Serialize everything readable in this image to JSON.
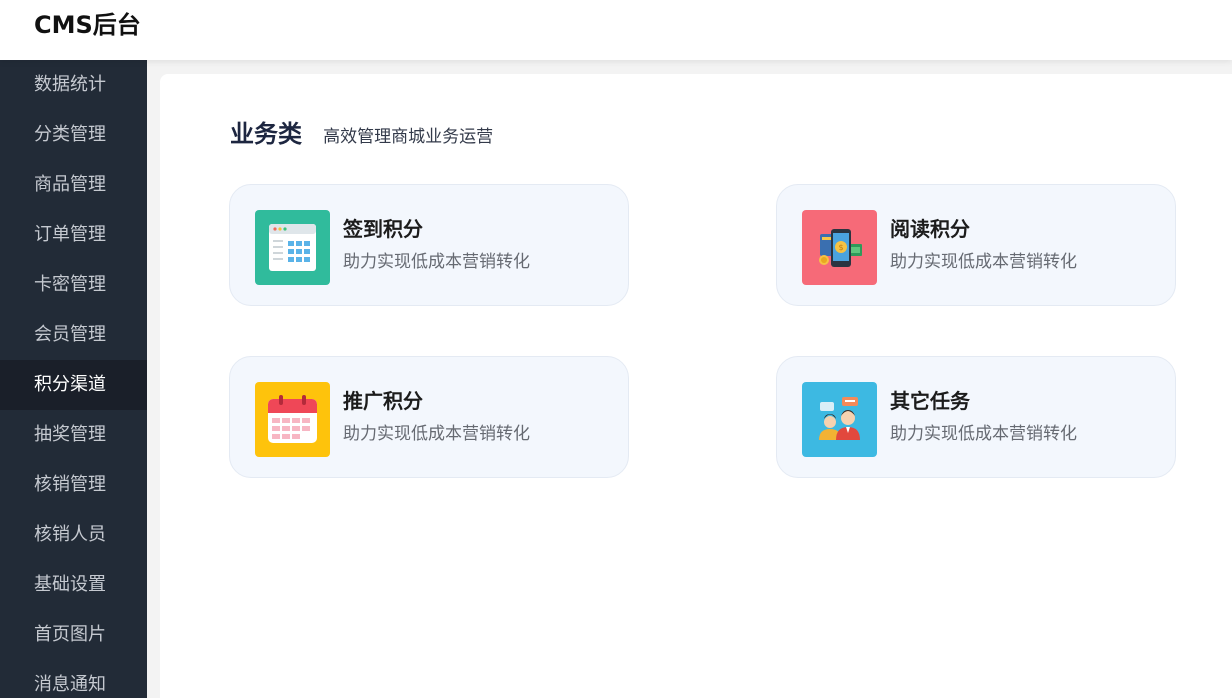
{
  "header": {
    "logo": "CMS后台"
  },
  "sidebar": {
    "items": [
      {
        "label": "数据统计"
      },
      {
        "label": "分类管理"
      },
      {
        "label": "商品管理"
      },
      {
        "label": "订单管理"
      },
      {
        "label": "卡密管理"
      },
      {
        "label": "会员管理"
      },
      {
        "label": "积分渠道",
        "active": true
      },
      {
        "label": "抽奖管理"
      },
      {
        "label": "核销管理"
      },
      {
        "label": "核销人员"
      },
      {
        "label": "基础设置"
      },
      {
        "label": "首页图片"
      },
      {
        "label": "消息通知"
      }
    ]
  },
  "section": {
    "title": "业务类",
    "subtitle": "高效管理商城业务运营"
  },
  "cards": [
    {
      "title": "签到积分",
      "desc": "助力实现低成本营销转化",
      "icon": "calendar-grid-icon",
      "color": "#30bb9c"
    },
    {
      "title": "阅读积分",
      "desc": "助力实现低成本营销转化",
      "icon": "mobile-payment-icon",
      "color": "#f66a78"
    },
    {
      "title": "推广积分",
      "desc": "助力实现低成本营销转化",
      "icon": "calendar-icon",
      "color": "#fec30c"
    },
    {
      "title": "其它任务",
      "desc": "助力实现低成本营销转化",
      "icon": "people-chat-icon",
      "color": "#3db9e2"
    }
  ]
}
